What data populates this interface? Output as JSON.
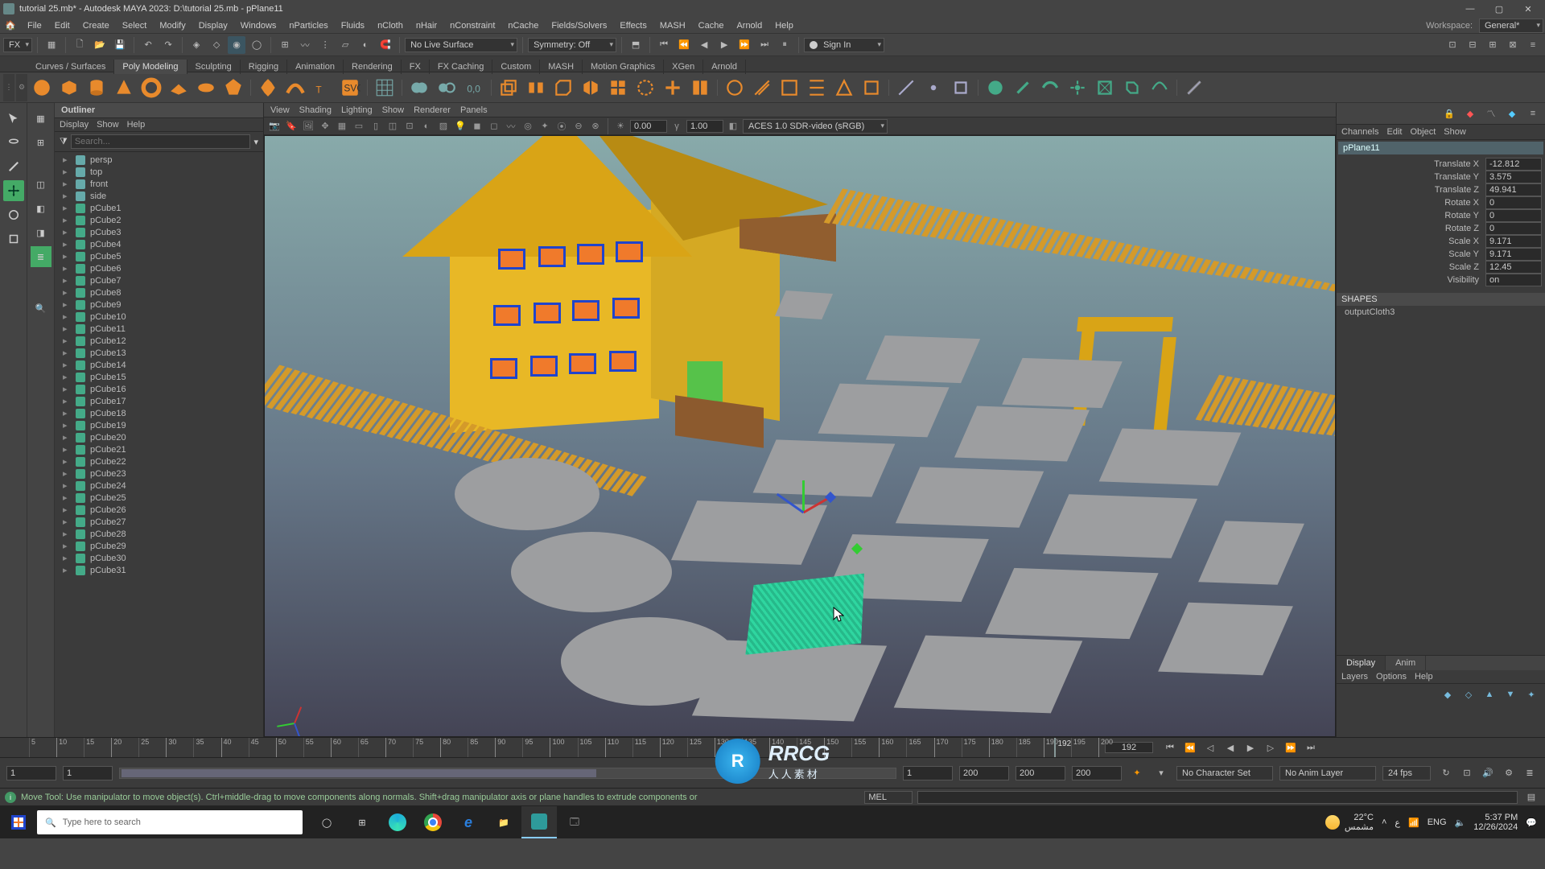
{
  "window": {
    "title": "tutorial 25.mb* - Autodesk MAYA 2023: D:\\tutorial 25.mb   -   pPlane11",
    "workspace_label": "Workspace:",
    "workspace_value": "General*"
  },
  "main_menu": [
    "File",
    "Edit",
    "Create",
    "Select",
    "Modify",
    "Display",
    "Windows",
    "nParticles",
    "Fluids",
    "nCloth",
    "nHair",
    "nConstraint",
    "nCache",
    "Fields/Solvers",
    "Effects",
    "MASH",
    "Cache",
    "Arnold",
    "Help"
  ],
  "toolrow": {
    "module_dropdown": "FX",
    "symmetry": "Symmetry: Off",
    "live_surface": "No Live Surface",
    "signin": "Sign In"
  },
  "shelf_tabs": [
    "Curves / Surfaces",
    "Poly Modeling",
    "Sculpting",
    "Rigging",
    "Animation",
    "Rendering",
    "FX",
    "FX Caching",
    "Custom",
    "MASH",
    "Motion Graphics",
    "XGen",
    "Arnold"
  ],
  "shelf_active": "Poly Modeling",
  "outliner": {
    "title": "Outliner",
    "menu": [
      "Display",
      "Show",
      "Help"
    ],
    "search_placeholder": "Search...",
    "cameras": [
      "persp",
      "top",
      "front",
      "side"
    ],
    "nodes": [
      "pCube1",
      "pCube2",
      "pCube3",
      "pCube4",
      "pCube5",
      "pCube6",
      "pCube7",
      "pCube8",
      "pCube9",
      "pCube10",
      "pCube11",
      "pCube12",
      "pCube13",
      "pCube14",
      "pCube15",
      "pCube16",
      "pCube17",
      "pCube18",
      "pCube19",
      "pCube20",
      "pCube21",
      "pCube22",
      "pCube23",
      "pCube24",
      "pCube25",
      "pCube26",
      "pCube27",
      "pCube28",
      "pCube29",
      "pCube30",
      "pCube31"
    ]
  },
  "viewport_panel": {
    "menu": [
      "View",
      "Shading",
      "Lighting",
      "Show",
      "Renderer",
      "Panels"
    ],
    "exposure": "0.00",
    "gamma": "1.00",
    "color_space": "ACES 1.0 SDR-video (sRGB)"
  },
  "channel_box": {
    "menu": [
      "Channels",
      "Edit",
      "Object",
      "Show"
    ],
    "selection": "pPlane11",
    "attrs": [
      {
        "name": "Translate X",
        "value": "-12.812"
      },
      {
        "name": "Translate Y",
        "value": "3.575"
      },
      {
        "name": "Translate Z",
        "value": "49.941"
      },
      {
        "name": "Rotate X",
        "value": "0"
      },
      {
        "name": "Rotate Y",
        "value": "0"
      },
      {
        "name": "Rotate Z",
        "value": "0"
      },
      {
        "name": "Scale X",
        "value": "9.171"
      },
      {
        "name": "Scale Y",
        "value": "9.171"
      },
      {
        "name": "Scale Z",
        "value": "12.45"
      },
      {
        "name": "Visibility",
        "value": "on"
      }
    ],
    "shapes_label": "SHAPES",
    "shape_name": "outputCloth3",
    "layer_tabs": [
      "Display",
      "Anim"
    ],
    "layer_menu": [
      "Layers",
      "Options",
      "Help"
    ]
  },
  "timeline": {
    "current_frame": "192",
    "start_display": "5",
    "ticks": [
      "5",
      "10",
      "15",
      "20",
      "25",
      "30",
      "35",
      "40",
      "45",
      "50",
      "55",
      "60",
      "65",
      "70",
      "75",
      "80",
      "85",
      "90",
      "95",
      "100",
      "105",
      "110",
      "115",
      "120",
      "125",
      "130",
      "135",
      "140",
      "145",
      "150",
      "155",
      "160",
      "165",
      "170",
      "175",
      "180",
      "185",
      "190",
      "195",
      "200"
    ]
  },
  "range": {
    "start_outer": "1",
    "start_inner": "1",
    "end_inner": "1",
    "end_outer": "200",
    "end_outer2": "200",
    "end_outer3": "200",
    "char_set": "No Character Set",
    "anim_layer": "No Anim Layer",
    "fps": "24 fps"
  },
  "helpline": {
    "mel": "MEL",
    "text": "Move Tool: Use manipulator to move object(s). Ctrl+middle-drag to move components along normals. Shift+drag manipulator axis or plane handles to extrude components or"
  },
  "taskbar": {
    "search_placeholder": "Type here to search",
    "weather_temp": "22°C",
    "weather_desc": "مشمس",
    "lang": "ENG",
    "time": "5:37 PM",
    "date": "12/26/2024",
    "arabic_lang": "ع"
  },
  "watermark_center": "RRCG",
  "watermark_sub": "人人素材"
}
